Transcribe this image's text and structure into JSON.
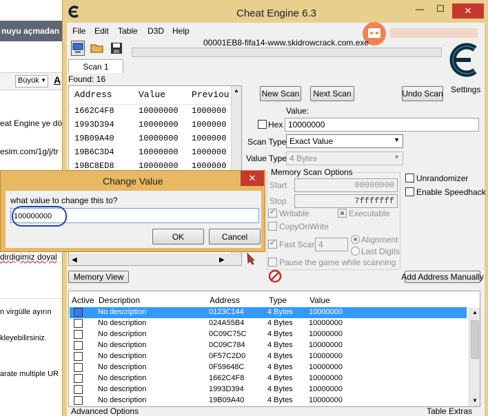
{
  "app": {
    "title": "Cheat Engine 6.3",
    "process": "00001EB8-fifa14-www.skidrowcrack.com.exe",
    "menu": [
      "File",
      "Edit",
      "Table",
      "D3D",
      "Help"
    ],
    "scan_tab": "Scan 1",
    "found": "Found: 16",
    "settings_label": "Settings"
  },
  "background_page": {
    "title": "nuyu açmadan ö",
    "font_select": "Büyük",
    "lines": [
      "eat Engine ye dön",
      "esim.com/1g/j/tr",
      "dirdigimiz doyal",
      "n virgülle ayırın",
      "kleyebilirsiniz.",
      "arate multiple UR"
    ]
  },
  "results_list": {
    "headers": [
      "Address",
      "Value",
      "Previou"
    ],
    "rows": [
      [
        "1662C4F8",
        "10000000",
        "1000000"
      ],
      [
        "1993D394",
        "10000000",
        "1000000"
      ],
      [
        "19B09A40",
        "10000000",
        "1000000"
      ],
      [
        "19B6C3D4",
        "10000000",
        "1000000"
      ],
      [
        "19BC8ED8",
        "10000000",
        "1000000"
      ]
    ]
  },
  "scan_buttons": {
    "new": "New Scan",
    "next": "Next Scan",
    "undo": "Undo Scan"
  },
  "value_section": {
    "label": "Value:",
    "hex_label": "Hex",
    "value": "10000000",
    "scan_type_label": "Scan Type",
    "scan_type": "Exact Value",
    "value_type_label": "Value Type",
    "value_type": "4 Bytes"
  },
  "memory_options": {
    "title": "Memory Scan Options",
    "start_label": "Start",
    "start_value": "00000000",
    "stop_label": "Stop",
    "stop_value": "7fffffff",
    "writable": "Writable",
    "executable": "Executable",
    "copy_on_write": "CopyOnWrite",
    "fast_scan": "Fast Scan",
    "fast_scan_value": "4",
    "alignment": "Alignment",
    "last_digits": "Last Digits",
    "pause": "Pause the game while scanning"
  },
  "side_options": {
    "unrandomizer": "Unrandomizer",
    "speedhack": "Enable Speedhack"
  },
  "memory_view_btn": "Memory View",
  "add_address_btn": "Add Address Manually",
  "cheat_table": {
    "headers": [
      "Active",
      "Description",
      "Address",
      "Type",
      "Value"
    ],
    "rows": [
      [
        "No description",
        "0123C144",
        "4 Bytes",
        "10000000"
      ],
      [
        "No description",
        "024A55B4",
        "4 Bytes",
        "10000000"
      ],
      [
        "No description",
        "0C09C75C",
        "4 Bytes",
        "10000000"
      ],
      [
        "No description",
        "0C09C784",
        "4 Bytes",
        "10000000"
      ],
      [
        "No description",
        "0F57C2D0",
        "4 Bytes",
        "10000000"
      ],
      [
        "No description",
        "0F59648C",
        "4 Bytes",
        "10000000"
      ],
      [
        "No description",
        "1662C4F8",
        "4 Bytes",
        "10000000"
      ],
      [
        "No description",
        "1993D394",
        "4 Bytes",
        "10000000"
      ],
      [
        "No description",
        "19B09A40",
        "4 Bytes",
        "10000000"
      ]
    ]
  },
  "footer": {
    "advanced": "Advanced Options",
    "extras": "Table Extras"
  },
  "dialog": {
    "title": "Change Value",
    "prompt": "what value to change this to?",
    "value": "100000000",
    "ok": "OK",
    "cancel": "Cancel"
  },
  "window_controls": {
    "min": "—",
    "max": "☐",
    "close": "✕"
  },
  "colors": {
    "titlebar": "#e8cf8e",
    "dialog_border": "#e8b863",
    "close_red": "#c7392d",
    "selection": "#3399ff",
    "window_bg": "#f0f0f0"
  }
}
